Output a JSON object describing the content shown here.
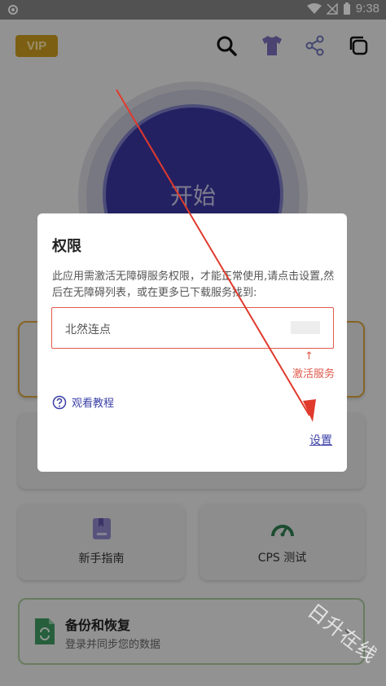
{
  "status_bar": {
    "time": "9:38"
  },
  "app": {
    "vip_label": "VIP",
    "start_label": "开始",
    "grid": {
      "beginner_guide": "新手指南",
      "cps_test": "CPS 测试"
    },
    "backup": {
      "title": "备份和恢复",
      "subtitle": "登录并同步您的数据"
    }
  },
  "dialog": {
    "title": "权限",
    "message": "此应用需激活无障碍服务权限，才能正常使用,请点击设置,然后在无障碍列表，或在更多已下载服务找到:",
    "service_name": "北然连点",
    "activate_arrow": "↑",
    "activate_label": "激活服务",
    "tutorial_label": "观看教程",
    "settings_label": "设置"
  },
  "watermark": "日升在线",
  "colors": {
    "accent": "#3b3fa6",
    "highlight_red": "#e05a4c",
    "vip_gold": "#c99a1e",
    "start_blue": "#3a36a0"
  }
}
